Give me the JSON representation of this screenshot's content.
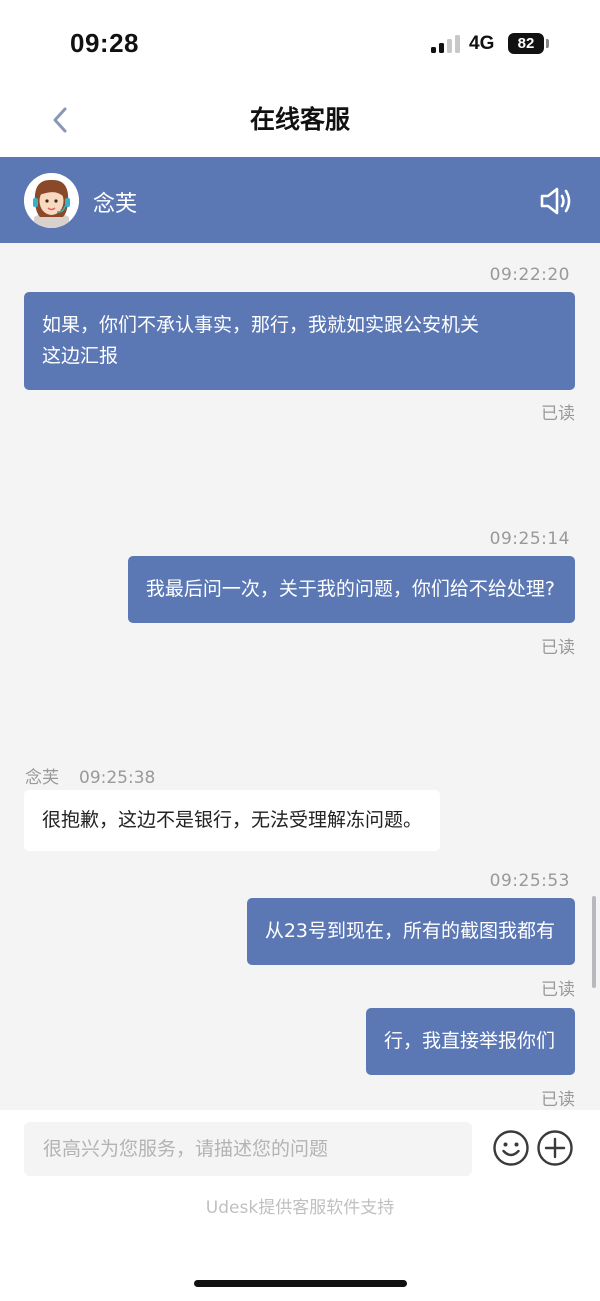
{
  "status_bar": {
    "time": "09:28",
    "network": "4G",
    "battery": "82"
  },
  "nav": {
    "title": "在线客服",
    "back_icon": "chevron-left-icon"
  },
  "agent": {
    "name": "念芙",
    "avatar_icon": "agent-avatar-icon",
    "speaker_icon": "speaker-icon"
  },
  "messages": [
    {
      "direction": "outgoing",
      "time": "09:22:20",
      "lines": [
        "如果，你们不承认事实，那行，我就如实跟公安机关",
        "这边汇报"
      ],
      "status": "已读"
    },
    {
      "direction": "outgoing",
      "time": "09:25:14",
      "lines": [
        "我最后问一次，关于我的问题，你们给不给处理?"
      ],
      "status": "已读"
    },
    {
      "direction": "incoming",
      "sender": "念芙",
      "time": "09:25:38",
      "lines": [
        "很抱歉，这边不是银行，无法受理解冻问题。"
      ]
    },
    {
      "direction": "outgoing",
      "time": "09:25:53",
      "lines": [
        "从23号到现在，所有的截图我都有"
      ],
      "status": "已读"
    },
    {
      "direction": "outgoing",
      "lines": [
        "行，我直接举报你们"
      ],
      "status": "已读"
    }
  ],
  "input": {
    "placeholder": "很高兴为您服务，请描述您的问题",
    "emoji_icon": "emoji-icon",
    "add_icon": "plus-circle-icon"
  },
  "footer": {
    "powered_by": "Udesk提供客服软件支持"
  },
  "colors": {
    "accent": "#5b78b5",
    "background": "#f4f4f5",
    "muted_text": "#999999"
  }
}
